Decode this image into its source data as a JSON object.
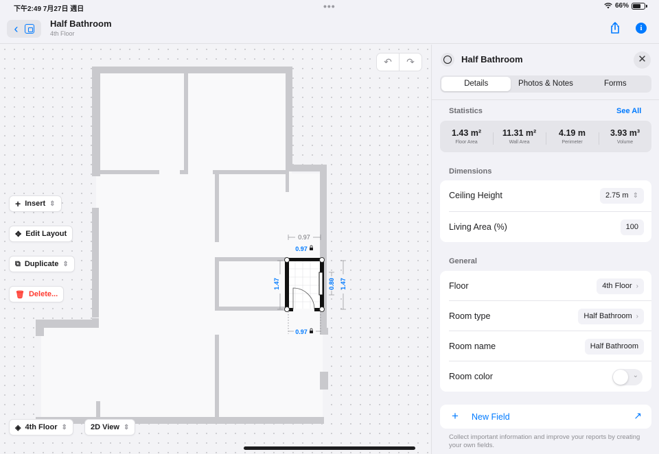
{
  "status_bar": {
    "time": "下午2:49  7月27日 週日",
    "battery": "66%"
  },
  "header": {
    "title": "Half Bathroom",
    "subtitle": "4th Floor"
  },
  "plan": {
    "top_dim": "0.97",
    "sel_width": "0.97",
    "sel_width_bottom": "0.97",
    "left_dim": "1.47",
    "right_dim": "1.47",
    "inner_dim": "0.80"
  },
  "tools": {
    "insert": "Insert",
    "edit_layout": "Edit Layout",
    "duplicate": "Duplicate",
    "delete": "Delete..."
  },
  "bottom": {
    "floor": "4th Floor",
    "view": "2D View"
  },
  "panel": {
    "title": "Half Bathroom",
    "tabs": [
      "Details",
      "Photos & Notes",
      "Forms"
    ],
    "statistics_label": "Statistics",
    "see_all": "See All",
    "stats": [
      {
        "value": "1.43 m²",
        "label": "Floor Area"
      },
      {
        "value": "11.31 m²",
        "label": "Wall Area"
      },
      {
        "value": "4.19 m",
        "label": "Perimeter"
      },
      {
        "value": "3.93 m³",
        "label": "Volume"
      }
    ],
    "dimensions_label": "Dimensions",
    "ceiling_height_label": "Ceiling Height",
    "ceiling_height_value": "2.75 m",
    "living_area_label": "Living Area (%)",
    "living_area_value": "100",
    "general_label": "General",
    "floor_label": "Floor",
    "floor_value": "4th Floor",
    "room_type_label": "Room type",
    "room_type_value": "Half Bathroom",
    "room_name_label": "Room name",
    "room_name_value": "Half Bathroom",
    "room_color_label": "Room color",
    "new_field": "New Field",
    "footnote": "Collect important information and improve your reports by creating your own fields."
  }
}
